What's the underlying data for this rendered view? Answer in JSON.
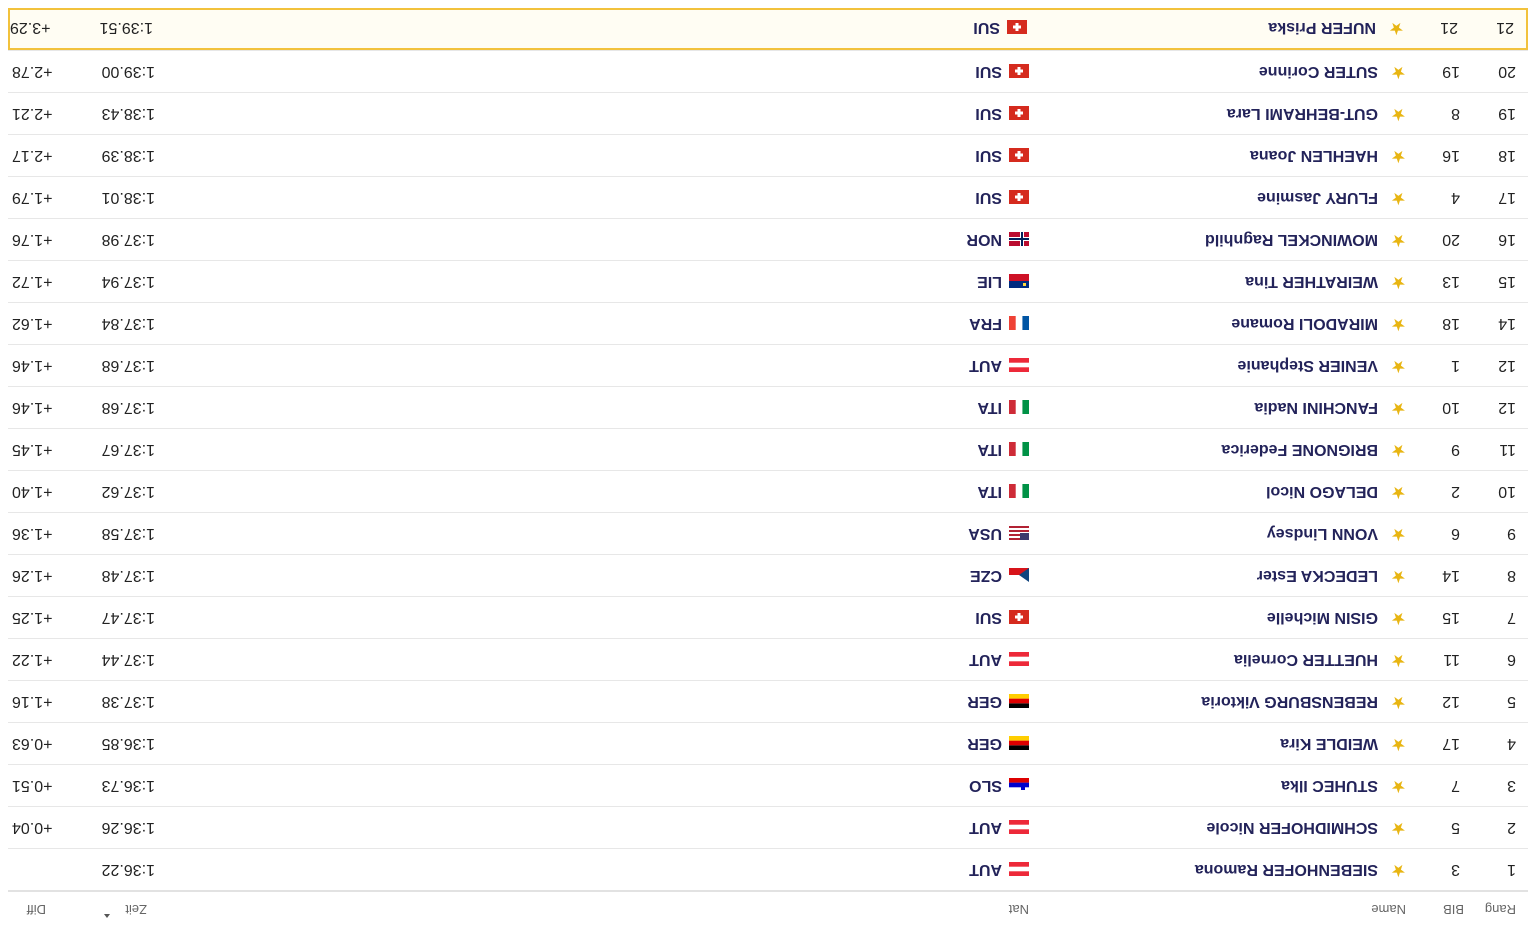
{
  "table": {
    "headers": {
      "rank": "Rang",
      "bib": "BIB",
      "name": "Name",
      "nat": "Nat",
      "time": "Zeit",
      "diff": "Diff"
    },
    "rows": [
      {
        "rank": "1",
        "bib": "3",
        "name": "SIEBENHOFER Ramona",
        "nat": "AUT",
        "time": "1:36.22",
        "diff": ""
      },
      {
        "rank": "2",
        "bib": "5",
        "name": "SCHMIDHOFER Nicole",
        "nat": "AUT",
        "time": "1:36.26",
        "diff": "+0.04"
      },
      {
        "rank": "3",
        "bib": "7",
        "name": "STUHEC Ilka",
        "nat": "SLO",
        "time": "1:36.73",
        "diff": "+0.51"
      },
      {
        "rank": "4",
        "bib": "17",
        "name": "WEIDLE Kira",
        "nat": "GER",
        "time": "1:36.85",
        "diff": "+0.63"
      },
      {
        "rank": "5",
        "bib": "12",
        "name": "REBENSBURG Viktoria",
        "nat": "GER",
        "time": "1:37.38",
        "diff": "+1.16"
      },
      {
        "rank": "6",
        "bib": "11",
        "name": "HUETTER Cornelia",
        "nat": "AUT",
        "time": "1:37.44",
        "diff": "+1.22"
      },
      {
        "rank": "7",
        "bib": "15",
        "name": "GISIN Michelle",
        "nat": "SUI",
        "time": "1:37.47",
        "diff": "+1.25"
      },
      {
        "rank": "8",
        "bib": "14",
        "name": "LEDECKA Ester",
        "nat": "CZE",
        "time": "1:37.48",
        "diff": "+1.26"
      },
      {
        "rank": "9",
        "bib": "6",
        "name": "VONN Lindsey",
        "nat": "USA",
        "time": "1:37.58",
        "diff": "+1.36"
      },
      {
        "rank": "10",
        "bib": "2",
        "name": "DELAGO Nicol",
        "nat": "ITA",
        "time": "1:37.62",
        "diff": "+1.40"
      },
      {
        "rank": "11",
        "bib": "9",
        "name": "BRIGNONE Federica",
        "nat": "ITA",
        "time": "1:37.67",
        "diff": "+1.45"
      },
      {
        "rank": "12",
        "bib": "10",
        "name": "FANCHINI Nadia",
        "nat": "ITA",
        "time": "1:37.68",
        "diff": "+1.46"
      },
      {
        "rank": "12",
        "bib": "1",
        "name": "VENIER Stephanie",
        "nat": "AUT",
        "time": "1:37.68",
        "diff": "+1.46"
      },
      {
        "rank": "14",
        "bib": "18",
        "name": "MIRADOLI Romane",
        "nat": "FRA",
        "time": "1:37.84",
        "diff": "+1.62"
      },
      {
        "rank": "15",
        "bib": "13",
        "name": "WEIRATHER Tina",
        "nat": "LIE",
        "time": "1:37.94",
        "diff": "+1.72"
      },
      {
        "rank": "16",
        "bib": "20",
        "name": "MOWINCKEL Ragnhild",
        "nat": "NOR",
        "time": "1:37.98",
        "diff": "+1.76"
      },
      {
        "rank": "17",
        "bib": "4",
        "name": "FLURY Jasmine",
        "nat": "SUI",
        "time": "1:38.01",
        "diff": "+1.79"
      },
      {
        "rank": "18",
        "bib": "16",
        "name": "HAEHLEN Joana",
        "nat": "SUI",
        "time": "1:38.39",
        "diff": "+2.17"
      },
      {
        "rank": "19",
        "bib": "8",
        "name": "GUT-BEHRAMI Lara",
        "nat": "SUI",
        "time": "1:38.43",
        "diff": "+2.21"
      },
      {
        "rank": "20",
        "bib": "19",
        "name": "SUTER Corinne",
        "nat": "SUI",
        "time": "1:39.00",
        "diff": "+2.78"
      },
      {
        "rank": "21",
        "bib": "21",
        "name": "NUFER Priska",
        "nat": "SUI",
        "time": "1:39.51",
        "diff": "+3.29",
        "highlighted": true
      }
    ]
  },
  "icons": {
    "favorite": "star-icon",
    "sort": "sort-arrow-icon"
  },
  "colors": {
    "star": "#e8b512",
    "highlight": "#f2c23c",
    "name_text": "#23235a"
  }
}
